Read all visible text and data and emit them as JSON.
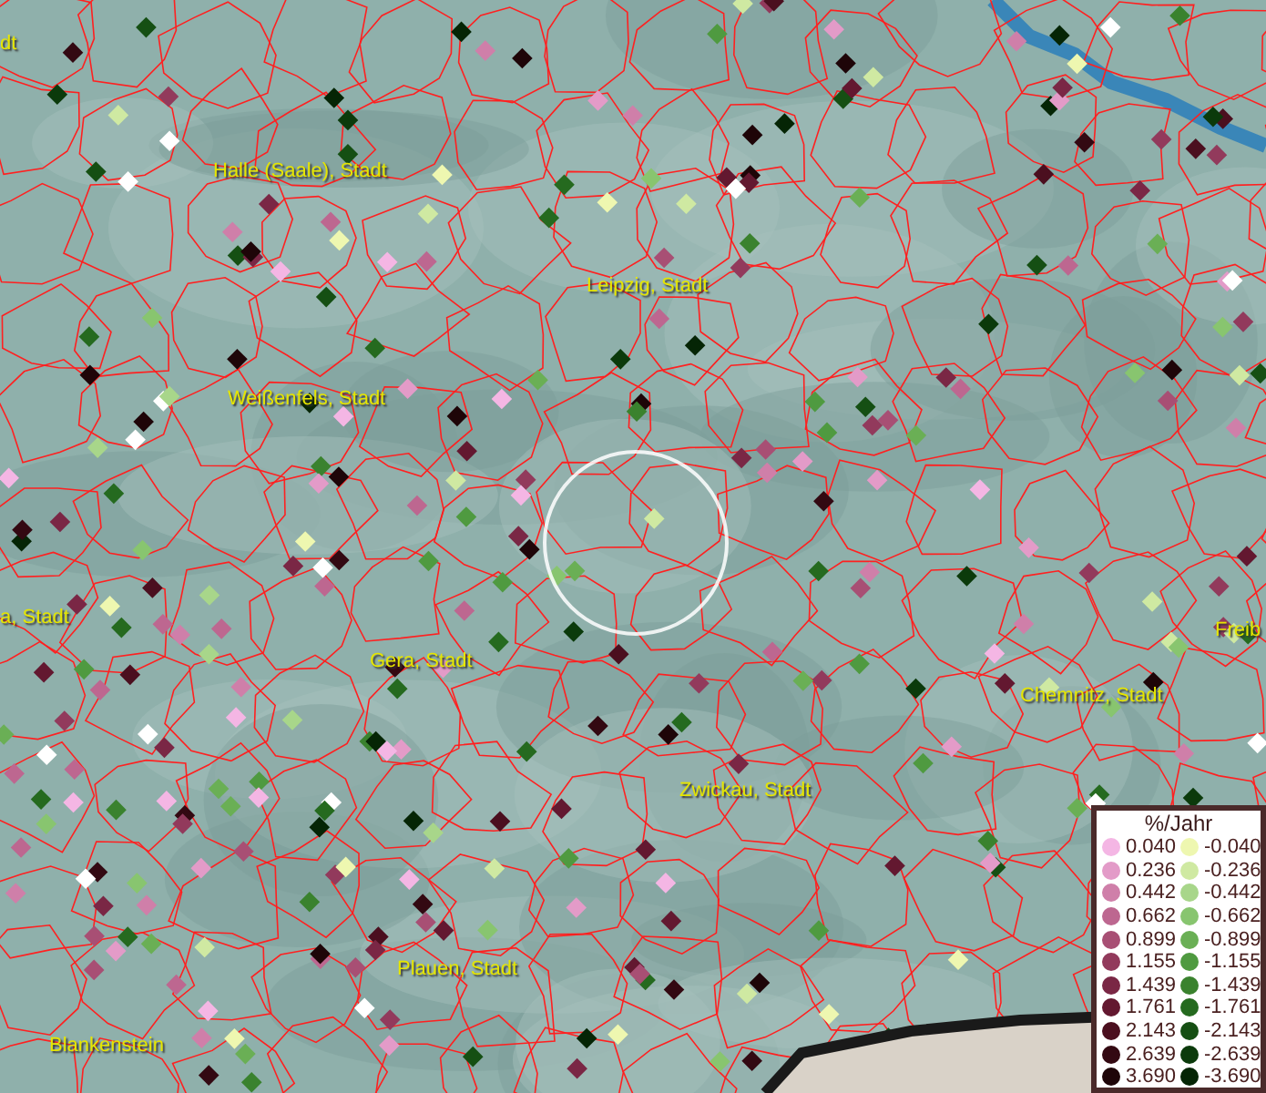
{
  "map": {
    "places": [
      "dt",
      "Halle (Saale), Stadt",
      "Leipzig, Stadt",
      "Weißenfels, Stadt",
      "a, Stadt",
      "Gera, Stadt",
      "Freib",
      "Chemnitz, Stadt",
      "Zwickau, Stadt",
      "Plauen, Stadt",
      "Blankenstein"
    ]
  },
  "legend": {
    "title": "%/Jahr",
    "positive": [
      {
        "label": "0.040",
        "color": "#f4b6e4"
      },
      {
        "label": "0.236",
        "color": "#e39bc8"
      },
      {
        "label": "0.442",
        "color": "#cf7fa9"
      },
      {
        "label": "0.662",
        "color": "#bd6790"
      },
      {
        "label": "0.899",
        "color": "#a84f74"
      },
      {
        "label": "1.155",
        "color": "#923a5c"
      },
      {
        "label": "1.439",
        "color": "#7a2745"
      },
      {
        "label": "1.761",
        "color": "#631830"
      },
      {
        "label": "2.143",
        "color": "#4b0f1f"
      },
      {
        "label": "2.639",
        "color": "#330912"
      },
      {
        "label": "3.690",
        "color": "#1e0508"
      }
    ],
    "negative": [
      {
        "label": "-0.040",
        "color": "#eef7b0"
      },
      {
        "label": "-0.236",
        "color": "#cfe9a2"
      },
      {
        "label": "-0.442",
        "color": "#a8d68a"
      },
      {
        "label": "-0.662",
        "color": "#88c56f"
      },
      {
        "label": "-0.899",
        "color": "#6aaf55"
      },
      {
        "label": "-1.155",
        "color": "#4f9a40"
      },
      {
        "label": "-1.439",
        "color": "#3a822e"
      },
      {
        "label": "-1.761",
        "color": "#256a1f"
      },
      {
        "label": "-2.143",
        "color": "#154f13"
      },
      {
        "label": "-2.639",
        "color": "#0b3a0b"
      },
      {
        "label": "-3.690",
        "color": "#052505"
      }
    ]
  }
}
